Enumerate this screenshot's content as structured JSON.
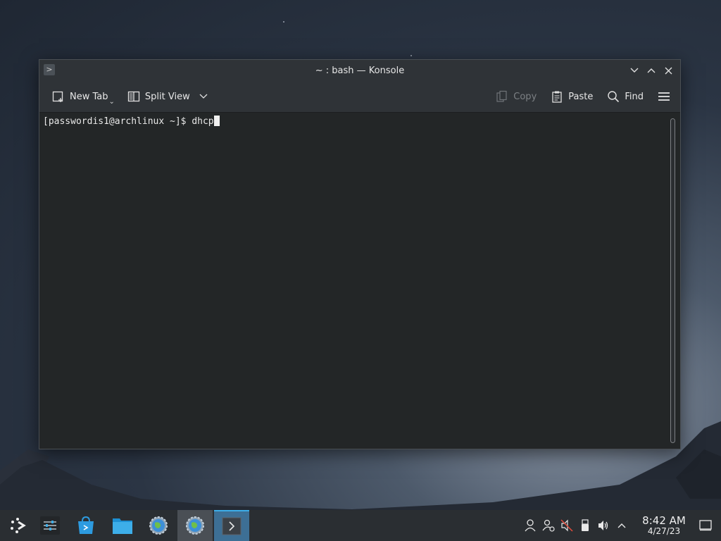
{
  "window": {
    "title": "~ : bash — Konsole",
    "toolbar": {
      "new_tab": "New Tab",
      "split_view": "Split View",
      "copy": "Copy",
      "paste": "Paste",
      "find": "Find"
    },
    "terminal": {
      "prompt": "[passwordis1@archlinux ~]$ ",
      "input": "dhcp"
    }
  },
  "taskbar": {
    "clock_time": "8:42 AM",
    "clock_date": "4/27/23"
  },
  "colors": {
    "accent": "#3daee9",
    "terminal_bg": "#232627",
    "titlebar_bg": "#2f3337",
    "taskbar_bg": "#2a2e32"
  }
}
